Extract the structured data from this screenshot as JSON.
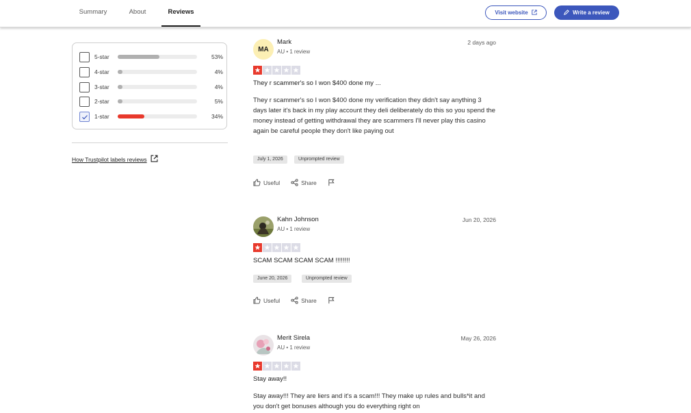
{
  "nav": {
    "tabs": [
      {
        "label": "Summary",
        "active": false
      },
      {
        "label": "About",
        "active": false
      },
      {
        "label": "Reviews",
        "active": true
      }
    ],
    "visit_website": "Visit website",
    "write_review": "Write a review"
  },
  "filter": {
    "rows": [
      {
        "label": "5-star",
        "percent": "53%",
        "fraction": 0.53,
        "checked": false
      },
      {
        "label": "4-star",
        "percent": "4%",
        "fraction": 0.04,
        "checked": false
      },
      {
        "label": "3-star",
        "percent": "4%",
        "fraction": 0.04,
        "checked": false
      },
      {
        "label": "2-star",
        "percent": "5%",
        "fraction": 0.05,
        "checked": false
      },
      {
        "label": "1-star",
        "percent": "34%",
        "fraction": 0.34,
        "checked": true
      }
    ],
    "labels_link": "How Trustpilot labels reviews"
  },
  "reviews": [
    {
      "initials": "MA",
      "name": "Mark",
      "meta": "AU • 1 review",
      "date": "2 days ago",
      "rating": 1,
      "title": "They r scammer's so I won $400 done my ...",
      "body": "They r scammer's so I won $400 done my verification they didn't say anything 3 days later it's back in my play account they deli deliberately do this so you spend the money instead of getting withdrawal they are scammers I'll never play this casino again be careful people they don't like paying out",
      "experience_date": "July 1, 2026",
      "tag": "Unprompted review",
      "useful": "Useful",
      "share": "Share"
    },
    {
      "initials": "",
      "name": "Kahn Johnson",
      "meta": "AU • 1 review",
      "date": "Jun 20, 2026",
      "rating": 1,
      "title": "SCAM SCAM SCAM SCAM !!!!!!!!",
      "body": "",
      "experience_date": "June 20, 2026",
      "tag": "Unprompted review",
      "useful": "Useful",
      "share": "Share"
    },
    {
      "initials": "",
      "name": "Merit Sirela",
      "meta": "AU • 1 review",
      "date": "May 26, 2026",
      "rating": 1,
      "title": "Stay away!!",
      "body": "Stay away!!! They are liers and it's a scam!!! They make up rules and bulls*it and you don't get bonuses although you do everything right on",
      "experience_date": "",
      "tag": "",
      "useful": "",
      "share": ""
    }
  ],
  "colors": {
    "accent": "#3c57bc",
    "star_red": "#e8392c",
    "star_empty": "#dcdce6",
    "avatar_yellow": "#fcefb4"
  },
  "icons": {
    "external": "external-link-icon",
    "pencil": "pencil-icon",
    "check": "check-icon",
    "star": "star-icon",
    "thumb": "thumbs-up-icon",
    "share": "share-icon",
    "flag": "flag-icon"
  }
}
